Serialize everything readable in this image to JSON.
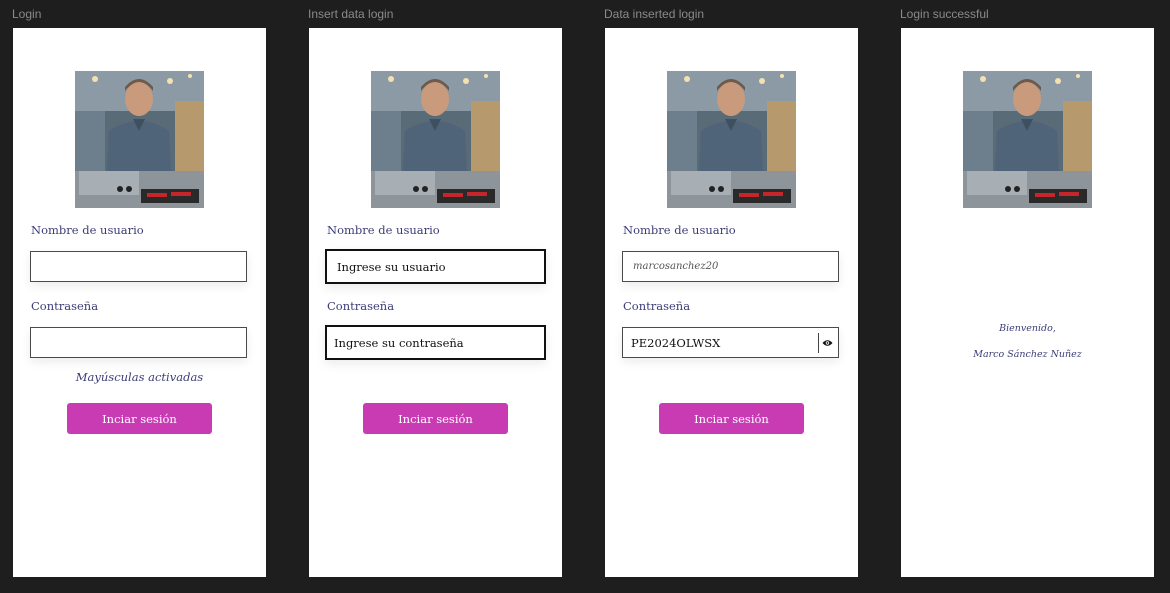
{
  "frames": [
    {
      "title": "Login",
      "username_label": "Nombre de usuario",
      "username_value": "",
      "username_placeholder": "",
      "password_label": "Contraseña",
      "password_value": "",
      "password_placeholder": "",
      "caps_hint": "Mayúsculas activadas",
      "button_label": "Inciar sesión"
    },
    {
      "title": "Insert data login",
      "username_label": "Nombre de usuario",
      "username_value": "",
      "username_placeholder": "Ingrese su usuario",
      "password_label": "Contraseña",
      "password_value": "",
      "password_placeholder": "Ingrese su contraseña",
      "button_label": "Inciar sesión"
    },
    {
      "title": "Data inserted login",
      "username_label": "Nombre de usuario",
      "username_value": "marcosanchez20",
      "username_placeholder": "",
      "password_label": "Contraseña",
      "password_value": "PE2024OLWSX",
      "password_placeholder": "",
      "password_toggle_icon": "eye-icon",
      "button_label": "Inciar sesión"
    },
    {
      "title": "Login successful",
      "welcome_line1": "Bienvenido,",
      "welcome_line2": "Marco Sánchez Nuñez"
    }
  ],
  "colors": {
    "canvas": "#1e1e1e",
    "frame": "#ffffff",
    "label_text": "#3c3c78",
    "button_bg": "#c93bb3",
    "button_text": "#ffffff"
  }
}
